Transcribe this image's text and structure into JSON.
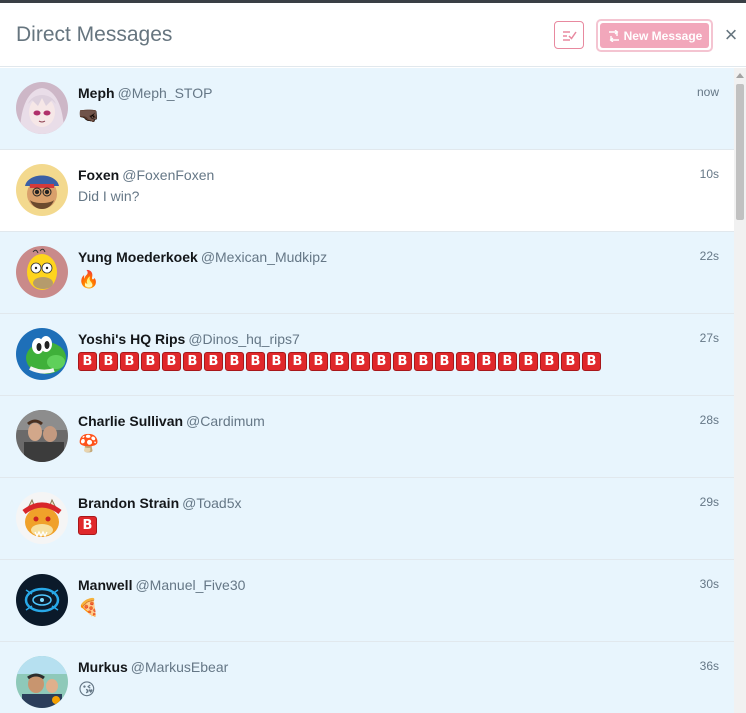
{
  "header": {
    "title": "Direct Messages",
    "new_message_label": "New Message",
    "close_glyph": "×"
  },
  "colors": {
    "accent": "#f2a7bb",
    "unread_bg": "#e8f5fd",
    "read_bg": "#ffffff",
    "handle": "#657786"
  },
  "icons": {
    "mark_read": "mark-all-read-icon",
    "new_message": "new-message-icon",
    "close": "close-icon"
  },
  "conversations": [
    {
      "name": "Meph",
      "handle": "@Meph_STOP",
      "time": "now",
      "preview": "🤜🏿",
      "read": false,
      "avatar": "anime-character-avatar"
    },
    {
      "name": "Foxen",
      "handle": "@FoxenFoxen",
      "time": "10s",
      "preview": "Did I win?",
      "read": true,
      "avatar": "cartoon-man-avatar"
    },
    {
      "name": "Yung Moederkoek",
      "handle": "@Mexican_Mudkipz",
      "time": "22s",
      "preview": "🔥",
      "read": false,
      "avatar": "homer-avatar"
    },
    {
      "name": "Yoshi's HQ Rips",
      "handle": "@Dinos_hq_rips7",
      "time": "27s",
      "preview": "B",
      "preview_repeat": 25,
      "read": false,
      "avatar": "yoshi-avatar"
    },
    {
      "name": "Charlie Sullivan",
      "handle": "@Cardimum",
      "time": "28s",
      "preview": "🍄",
      "read": false,
      "avatar": "photo-avatar"
    },
    {
      "name": "Brandon Strain",
      "handle": "@Toad5x",
      "time": "29s",
      "preview": "B",
      "preview_repeat": 1,
      "read": false,
      "avatar": "bowser-avatar"
    },
    {
      "name": "Manwell",
      "handle": "@Manuel_Five30",
      "time": "30s",
      "preview": "🍕",
      "read": false,
      "avatar": "blue-logo-avatar"
    },
    {
      "name": "Murkus",
      "handle": "@MarkusEbear",
      "time": "36s",
      "preview": "😘",
      "read": false,
      "avatar": "selfie-avatar"
    }
  ]
}
